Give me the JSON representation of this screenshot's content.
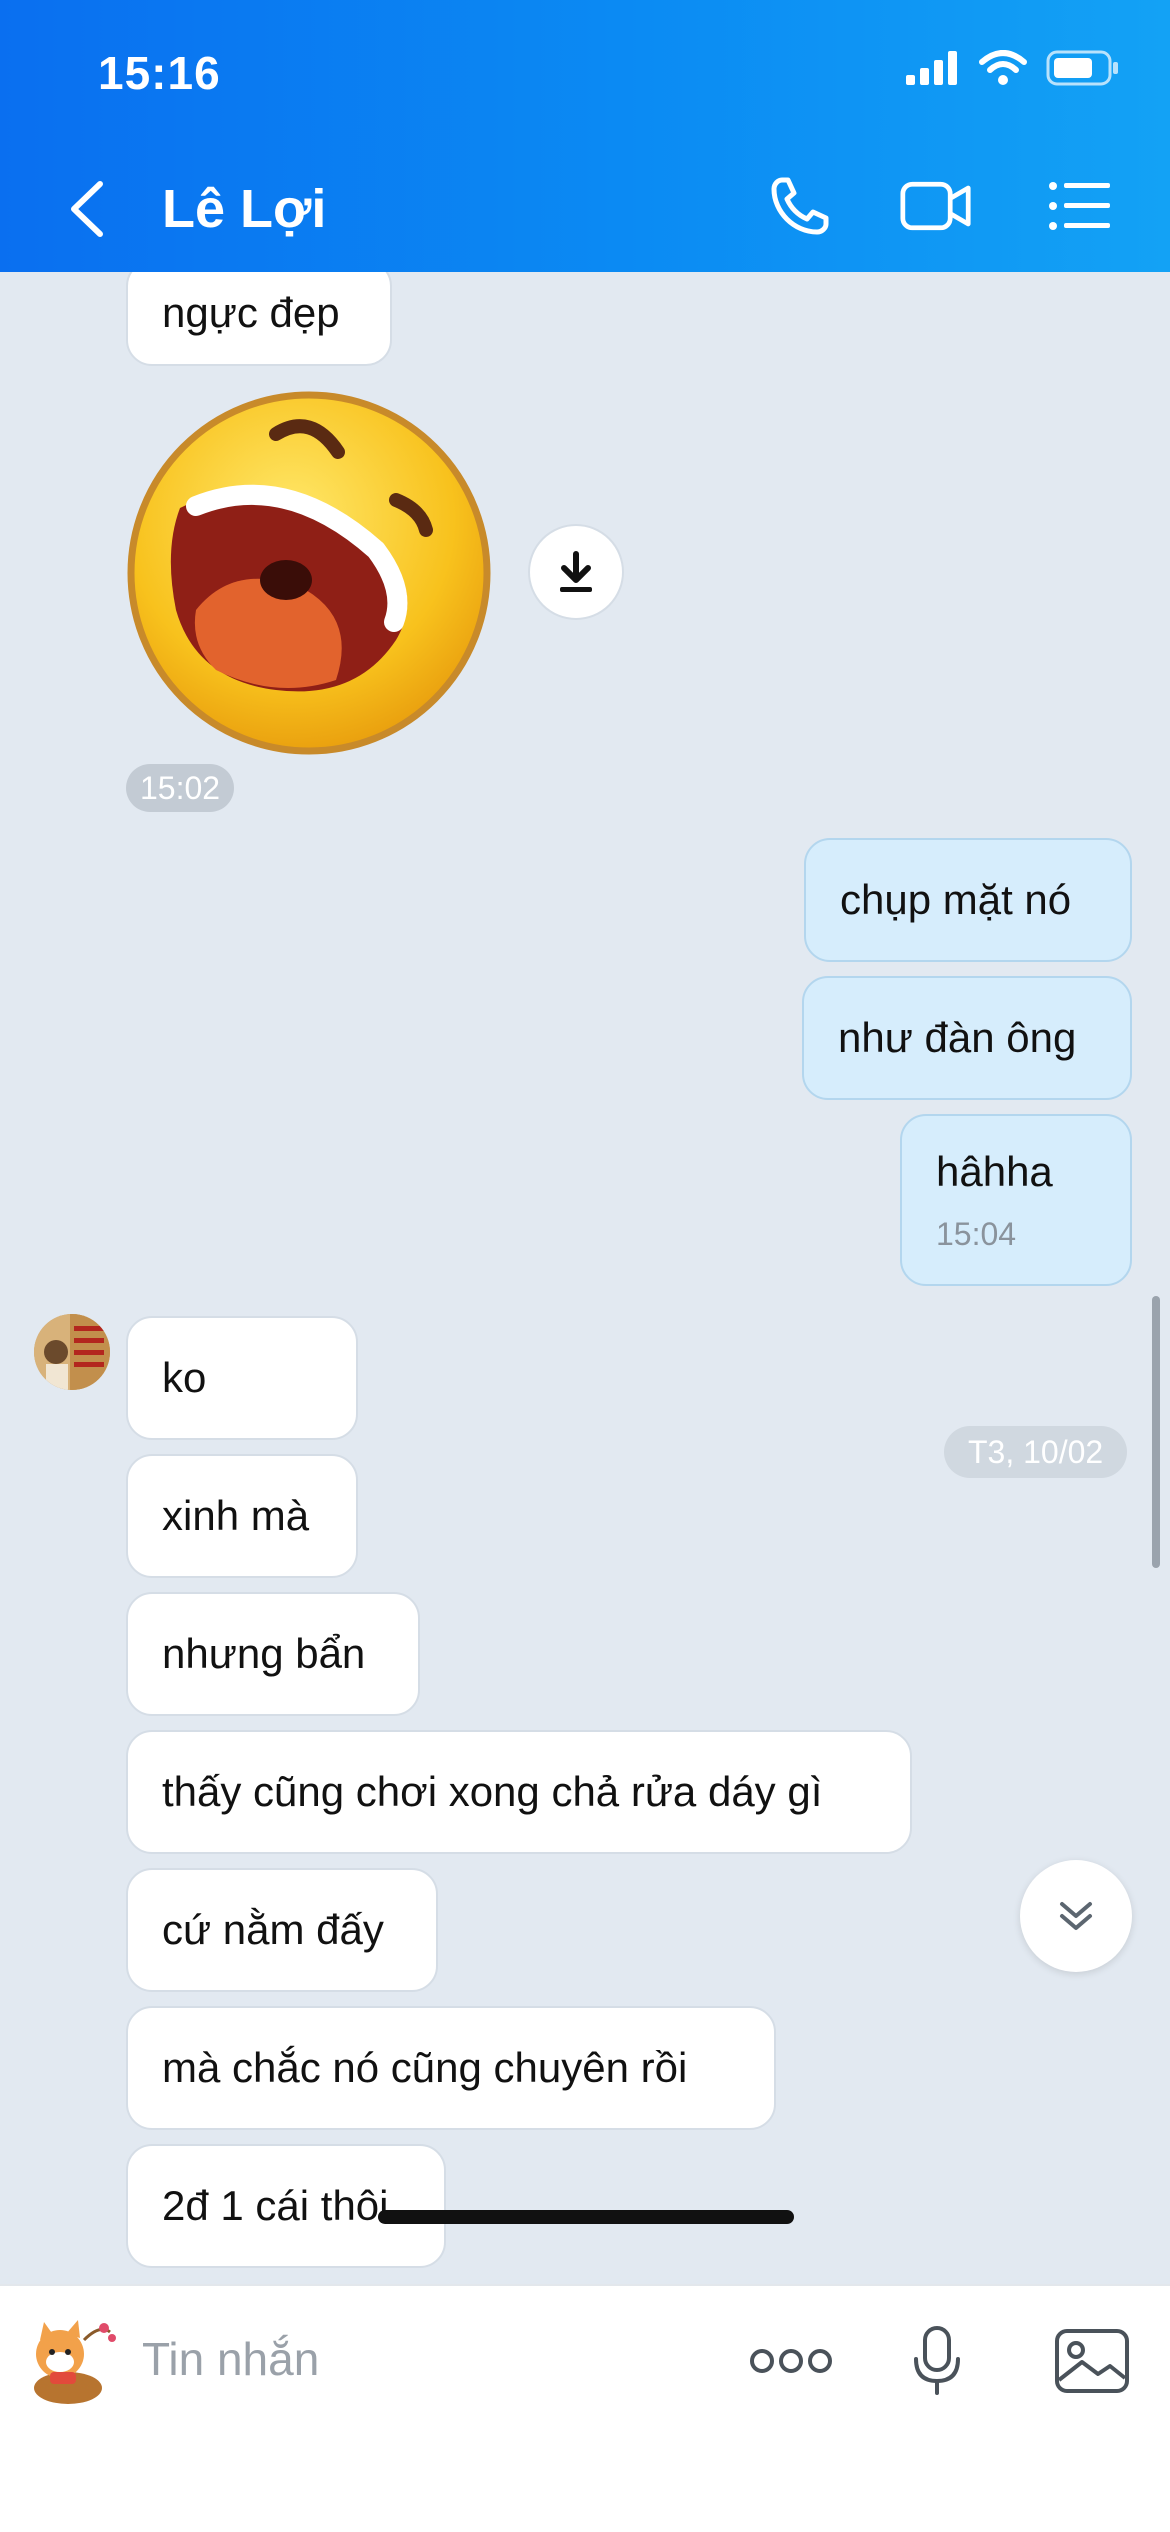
{
  "status_bar": {
    "time": "15:16"
  },
  "header": {
    "title": "Lê Lợi"
  },
  "messages": {
    "m1": "ngực đẹp",
    "sticker_time": "15:02",
    "o1": "chụp mặt nó",
    "o2": "như đàn ông",
    "o3": "hâhha",
    "o3_time": "15:04",
    "i1": "ko",
    "i2": "xinh mà",
    "i3": "nhưng bẩn",
    "i4": "thấy cũng chơi xong chả rửa dáy gì",
    "i5": "cứ nằm đấy",
    "i6": "mà chắc nó cũng chuyên rồi",
    "i7": "2đ 1 cái thôi"
  },
  "date_separator": "T3, 10/02",
  "input": {
    "placeholder": "Tin nhắn"
  },
  "icons": {
    "back": "chevron-left-icon",
    "call": "phone-icon",
    "video": "video-camera-icon",
    "menu": "list-icon",
    "download": "download-icon",
    "scroll": "double-chevron-down-icon",
    "more": "more-dots-icon",
    "mic": "microphone-icon",
    "image": "image-icon"
  },
  "colors": {
    "header_start": "#0a6ff0",
    "header_end": "#13a2f5",
    "chat_background": "#e2e9f1",
    "outgoing_bubble": "#d6edfc",
    "incoming_bubble": "#ffffff"
  }
}
